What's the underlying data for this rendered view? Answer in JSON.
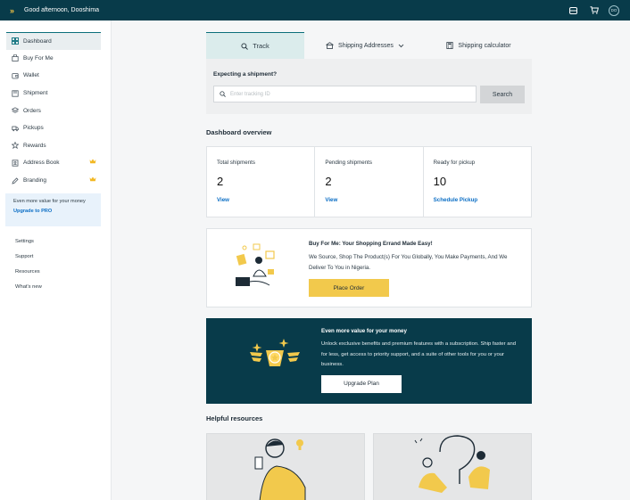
{
  "header": {
    "greeting": "Good afternoon, Dooshima",
    "avatar_initials": "DO",
    "icons": [
      "logo-icon",
      "inbox-icon",
      "cart-icon",
      "avatar"
    ]
  },
  "sidebar": {
    "items": [
      {
        "label": "Dashboard",
        "icon": "grid-icon",
        "active": true
      },
      {
        "label": "Buy For Me",
        "icon": "bag-icon"
      },
      {
        "label": "Wallet",
        "icon": "wallet-icon"
      },
      {
        "label": "Shipment",
        "icon": "box-icon"
      },
      {
        "label": "Orders",
        "icon": "layers-icon"
      },
      {
        "label": "Pickups",
        "icon": "pickup-icon"
      },
      {
        "label": "Rewards",
        "icon": "star-icon"
      },
      {
        "label": "Address Book",
        "icon": "book-icon",
        "pro": true
      },
      {
        "label": "Branding",
        "icon": "pen-icon",
        "pro": true
      }
    ],
    "promo": {
      "text": "Even more value for your money",
      "link": "Upgrade to PRO"
    },
    "links": [
      "Settings",
      "Support",
      "Resources",
      "What's new"
    ]
  },
  "tabs": [
    {
      "label": "Track",
      "icon": "search-icon",
      "active": true
    },
    {
      "label": "Shipping Addresses",
      "icon": "building-icon"
    },
    {
      "label": "Shipping calculator",
      "icon": "calculator-icon"
    }
  ],
  "track": {
    "question": "Expecting a shipment?",
    "placeholder": "Enter tracking ID",
    "button": "Search"
  },
  "overview": {
    "title": "Dashboard overview",
    "stats": [
      {
        "label": "Total shipments",
        "value": "2",
        "action": "View"
      },
      {
        "label": "Pending shipments",
        "value": "2",
        "action": "View"
      },
      {
        "label": "Ready for pickup",
        "value": "10",
        "action": "Schedule Pickup"
      }
    ]
  },
  "buy_for_me": {
    "title": "Buy For Me: Your Shopping Errand Made Easy!",
    "description": "We Source, Shop The Product(s) For You Globally, You Make Payments, And We Deliver To You in Nigeria.",
    "button": "Place Order"
  },
  "upgrade": {
    "title": "Even more value for your money",
    "description": "Unlock exclusive benefits and premium features with a subscription. Ship faster and for less, get access to priority support, and a suite of other tools for you or your business.",
    "button": "Upgrade Plan"
  },
  "resources": {
    "title": "Helpful resources"
  },
  "colors": {
    "brand": "#083b4a",
    "accent": "#f2c94c",
    "link": "#0b6ec5"
  }
}
